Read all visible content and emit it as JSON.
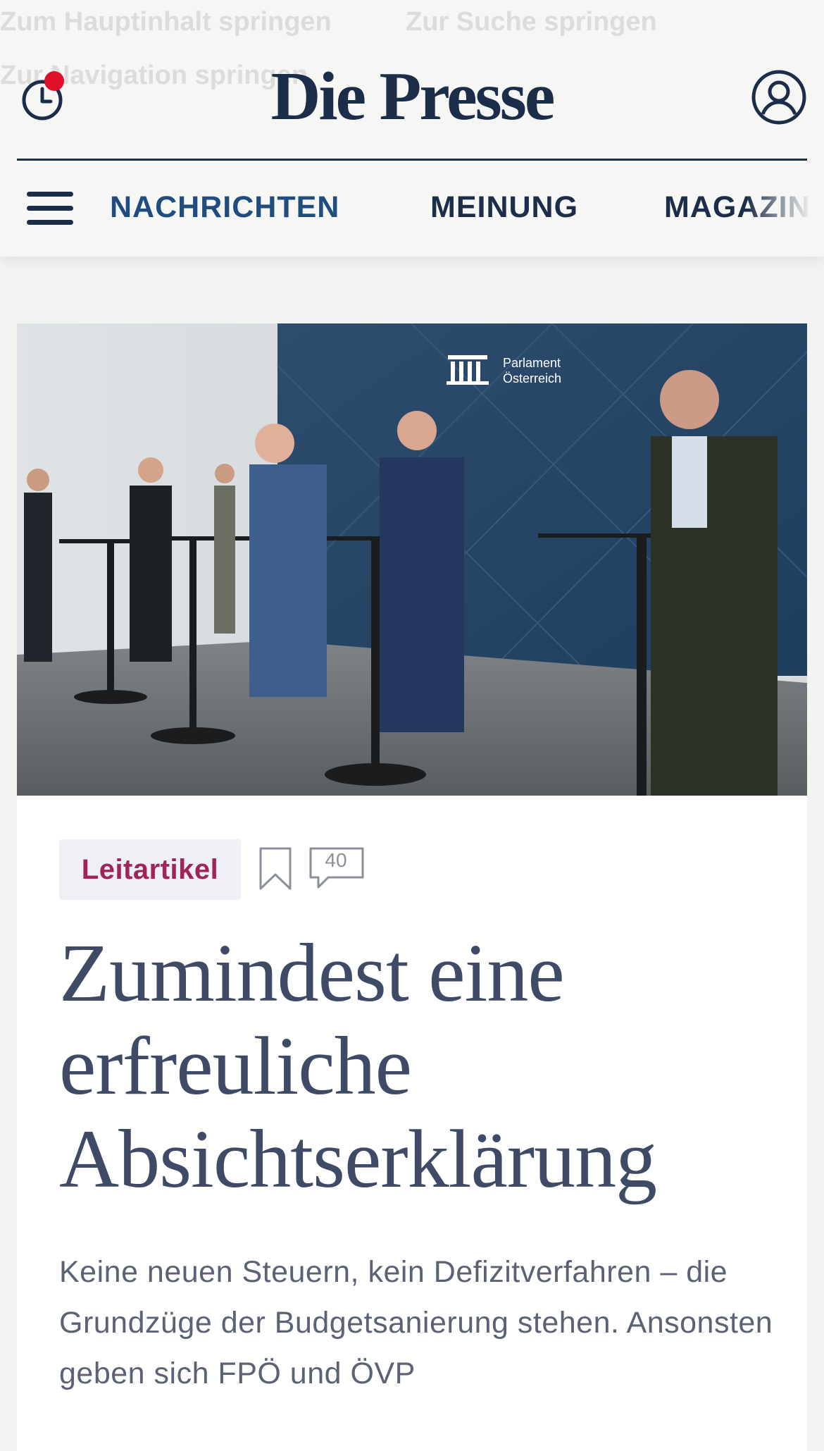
{
  "skip_links": [
    "Zum Hauptinhalt springen",
    "Zur Suche springen",
    "Zur Navigation springen"
  ],
  "header": {
    "brand": "Die Presse",
    "history_has_notification": true,
    "nav": [
      {
        "label": "NACHRICHTEN",
        "active": true
      },
      {
        "label": "MEINUNG",
        "active": false
      },
      {
        "label": "MAGAZIN",
        "active": false
      }
    ]
  },
  "article": {
    "image_text": {
      "line1": "Parlament",
      "line2": "Österreich"
    },
    "category": "Leitartikel",
    "comment_count": "40",
    "headline": "Zumindest eine erfreuliche Absichtserklärung",
    "teaser": "Keine neuen Steuern, kein Defizitverfahren – die Grundzüge der Budgetsanierung stehen. Ansonsten geben sich FPÖ und ÖVP"
  },
  "colors": {
    "brand_navy": "#1c2d49",
    "active_nav": "#1f4d80",
    "category": "#a0245b",
    "notification_dot": "#e0102a",
    "headline": "#3f4a66"
  }
}
